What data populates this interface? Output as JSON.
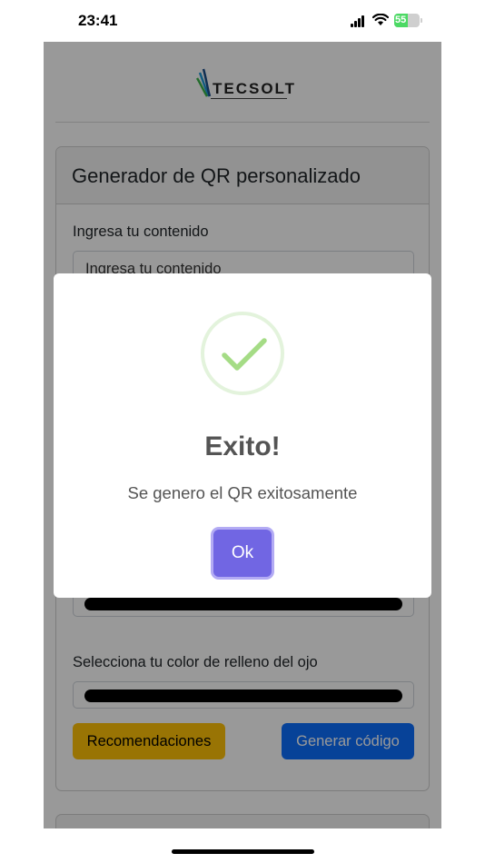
{
  "status_bar": {
    "time": "23:41",
    "battery_level": "55",
    "icons": [
      "signal-icon",
      "wifi-icon",
      "battery-charging-icon"
    ]
  },
  "page": {
    "logo_text": "TECSOLT",
    "card_title": "Generador de QR personalizado",
    "content_label": "Ingresa tu contenido",
    "content_value": "Ingresa tu contenido",
    "eye_fill_label": "Selecciona tu color de relleno del ojo",
    "recommendations_button": "Recomendaciones",
    "generate_button": "Generar código",
    "colors": {
      "warning": "#ffc107",
      "primary": "#0d6efd",
      "color_swatch": "#000000"
    }
  },
  "modal": {
    "icon": "success-check-icon",
    "title": "Exito!",
    "message": "Se genero el QR exitosamente",
    "ok_label": "Ok",
    "colors": {
      "ok_button": "#7166e3",
      "check": "#a5dc86"
    }
  }
}
